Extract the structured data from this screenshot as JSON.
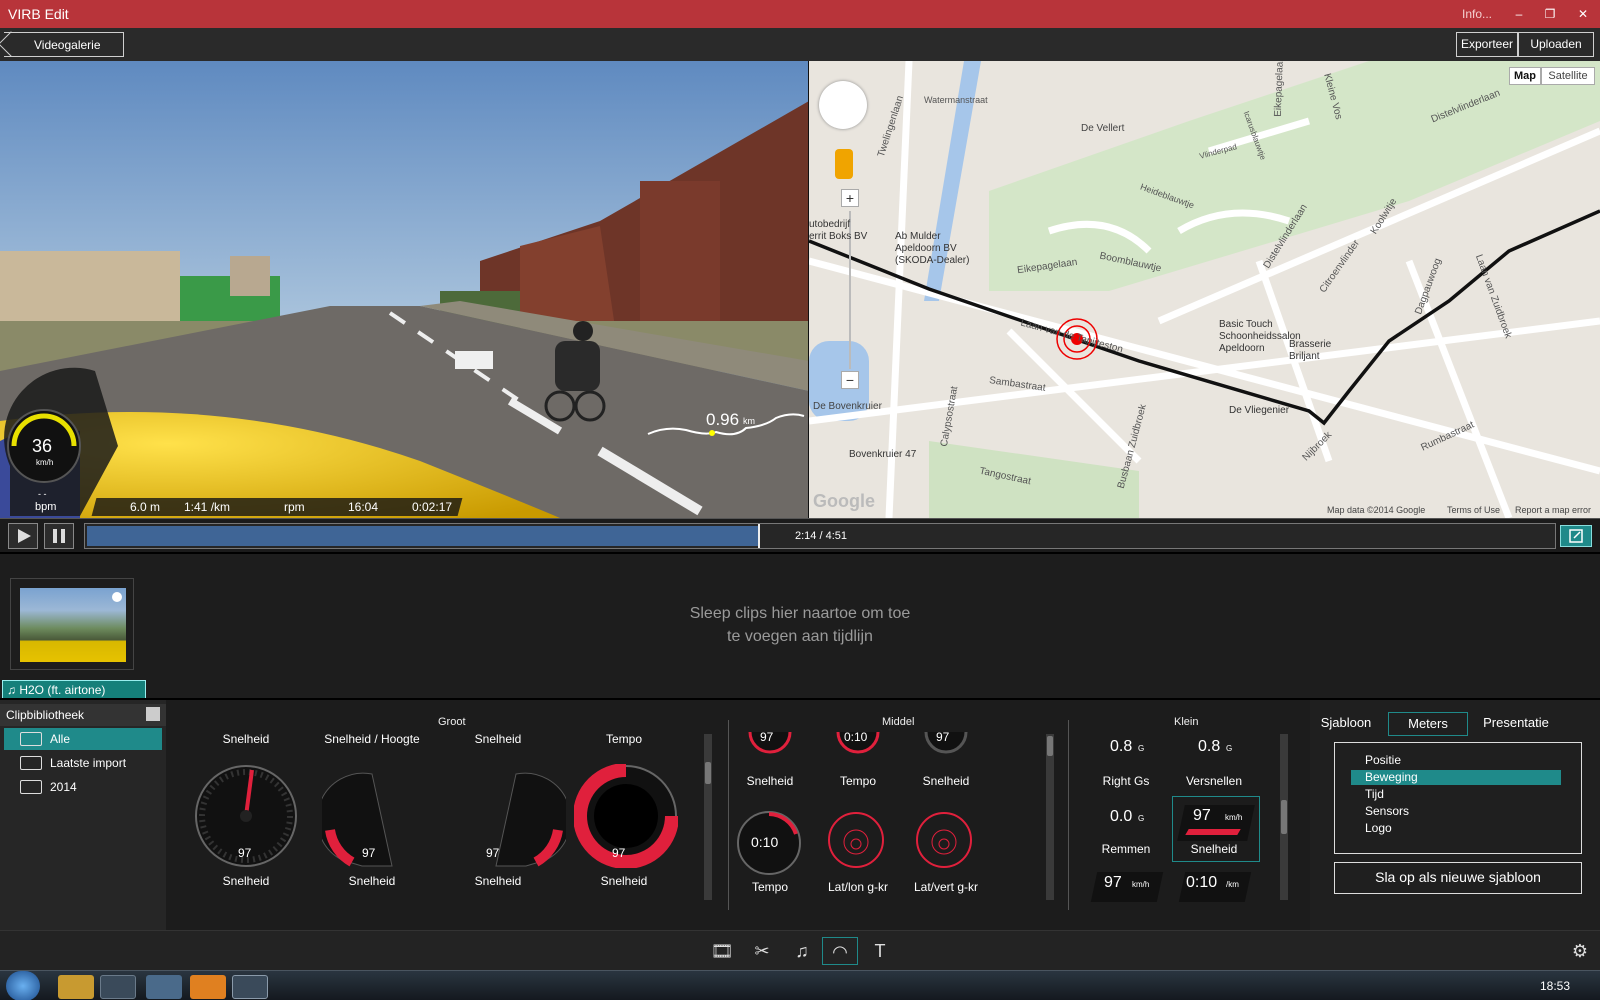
{
  "window": {
    "title": "VIRB Edit",
    "info": "Info...",
    "min": "‒",
    "restore": "❐",
    "close": "✕"
  },
  "nav": {
    "back": "Videogalerie",
    "export": "Exporteer",
    "upload": "Uploaden"
  },
  "video_overlay": {
    "speed": "36",
    "speed_unit": "km/h",
    "hr_dash": "- -",
    "hr_unit": "bpm",
    "distance_value": "0.96",
    "distance_unit": "km",
    "stats": [
      "6.0 m",
      "1:41 /km",
      "rpm",
      "16:04",
      "0:02:17"
    ]
  },
  "map": {
    "mode_map": "Map",
    "mode_satellite": "Satellite",
    "copyright": "Map data ©2014 Google",
    "terms": "Terms of Use",
    "report": "Report a map error",
    "google": "Google",
    "zoom_in": "+",
    "zoom_out": "−",
    "labels": [
      "Watermanstraat",
      "Twelingenlaan",
      "De Vellert",
      "Eikepagelaan",
      "Ab Mulder",
      "Apeldoorn BV",
      "(SKODA-Dealer)",
      "utobedrijf",
      "errit Boks BV",
      "Eikepagelaan",
      "Boomblauwtje",
      "Distelvlinderlaan",
      "Citroenvlinder",
      "Koolwitje",
      "Dagpauwoog",
      "Laan van Zuidbroek",
      "Basic Touch",
      "Schoonheidssalon",
      "Apeldoorn",
      "Brasserie",
      "Briljant",
      "Laan van de Tapijteston",
      "Sambastraat",
      "De Vliegenier",
      "Nijbroek",
      "Rumbastraat",
      "De Bovenkruier",
      "Bovenkruier 47",
      "Tangostraat",
      "Calypsostraat",
      "Busbaan Zuidbroek",
      "Heideblauwtje",
      "Vlinderpad",
      "Icarusblauwtje",
      "Kleine Vos",
      "Distelvlinderlaan"
    ]
  },
  "playback": {
    "time": "2:14 / 4:51",
    "progress": 0.458
  },
  "timeline": {
    "drop_hint_1": "Sleep clips hier naartoe om toe",
    "drop_hint_2": "te voegen aan tijdlijn",
    "audio": "H2O (ft. airtone)"
  },
  "library": {
    "title": "Clipbibliotheek",
    "items": [
      "Alle",
      "Laatste import",
      "2014"
    ]
  },
  "gauges": {
    "groot": "Groot",
    "middel": "Middel",
    "klein": "Klein",
    "groot_top": [
      "Snelheid",
      "Snelheid / Hoogte",
      "Snelheid",
      "Tempo"
    ],
    "groot_bottom": [
      "Snelheid",
      "Snelheid",
      "Snelheid",
      "Snelheid"
    ],
    "middel_row1": [
      "Snelheid",
      "Tempo",
      "Snelheid"
    ],
    "middel_row2": [
      "Tempo",
      "Lat/lon g-kr",
      "Lat/vert g-kr"
    ],
    "middel_values": [
      "97",
      "0:10",
      "97",
      "0:10"
    ],
    "klein_values_top": [
      "0.8",
      "0.8"
    ],
    "klein_unit_g": "G",
    "klein_labels_top": [
      "Right Gs",
      "Versnellen"
    ],
    "klein_value_brake": "0.0",
    "klein_labels_mid": [
      "Remmen",
      "Snelheid"
    ],
    "klein_speed": "97",
    "klein_speed_unit": "km/h",
    "klein_pace": "0:10",
    "klein_pace_unit": "/km",
    "big_speed": "97",
    "big_unit": "km/h"
  },
  "side": {
    "tabs": [
      "Sjabloon",
      "Meters",
      "Presentatie"
    ],
    "tree": [
      "Positie",
      "Beweging",
      "Tijd",
      "Sensors",
      "Logo"
    ],
    "save": "Sla op als nieuwe sjabloon"
  },
  "taskbar": {
    "clock": "18:53"
  },
  "colors": {
    "accent": "#1f8a8a",
    "titlebar": "#b8343a",
    "gauge_red": "#e0203c",
    "progress": "#3f6596"
  }
}
